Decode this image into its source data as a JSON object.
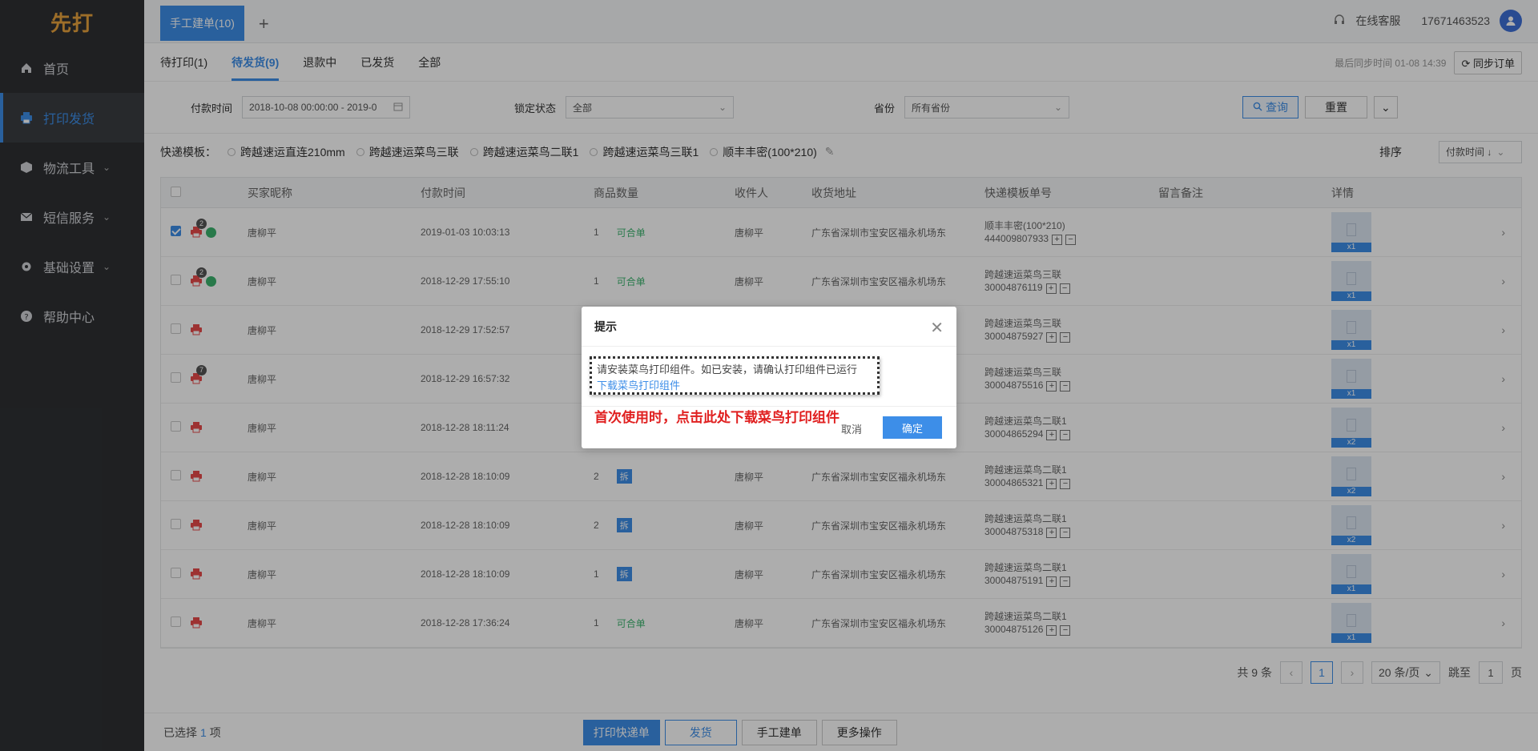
{
  "sidebar": {
    "logo": "先打",
    "items": [
      {
        "label": "首页",
        "icon": "home-icon"
      },
      {
        "label": "打印发货",
        "icon": "printer-icon"
      },
      {
        "label": "物流工具",
        "icon": "box-icon"
      },
      {
        "label": "短信服务",
        "icon": "mail-icon"
      },
      {
        "label": "基础设置",
        "icon": "gear-icon"
      },
      {
        "label": "帮助中心",
        "icon": "help-icon"
      }
    ]
  },
  "header": {
    "tab": "手工建单(10)",
    "plus": "+",
    "service": "在线客服",
    "phone": "17671463523"
  },
  "subtabs": [
    "待打印(1)",
    "待发货(9)",
    "退款中",
    "已发货",
    "全部"
  ],
  "sync": {
    "text": "最后同步时间 01-08 14:39",
    "button": "同步订单"
  },
  "filter": {
    "pay_time_label": "付款时间",
    "pay_time_value": "2018-10-08 00:00:00 - 2019-0",
    "lock_label": "锁定状态",
    "lock_value": "全部",
    "province_label": "省份",
    "province_value": "所有省份",
    "query": "查询",
    "reset": "重置"
  },
  "templates": {
    "label": "快递模板：",
    "options": [
      "跨越速运直连210mm",
      "跨越速运菜鸟三联",
      "跨越速运菜鸟二联1",
      "跨越速运菜鸟三联1",
      "顺丰丰密(100*210)"
    ],
    "sort_label": "排序",
    "sort_value": "付款时间 ↓"
  },
  "table": {
    "headers": [
      "买家昵称",
      "付款时间",
      "商品数量",
      "收件人",
      "收货地址",
      "快递模板单号",
      "留言备注",
      "详情"
    ],
    "rows": [
      {
        "buyer": "唐柳平",
        "time": "2019-01-03 10:03:13",
        "qty": "1",
        "tag": "可合单",
        "tagtype": "he",
        "recv": "唐柳平",
        "addr": "广东省深圳市宝安区福永机场东",
        "tpl": "顺丰丰密(100*210)",
        "no": "444009807933",
        "thumb": "x1",
        "checked": true,
        "badge": "2",
        "green": true
      },
      {
        "buyer": "唐柳平",
        "time": "2018-12-29 17:55:10",
        "qty": "1",
        "tag": "可合单",
        "tagtype": "he",
        "recv": "唐柳平",
        "addr": "广东省深圳市宝安区福永机场东",
        "tpl": "跨越速运菜鸟三联",
        "no": "30004876119",
        "thumb": "x1",
        "checked": false,
        "badge": "2",
        "green": true
      },
      {
        "buyer": "唐柳平",
        "time": "2018-12-29 17:52:57",
        "qty": "",
        "tag": "",
        "tagtype": "",
        "recv": "",
        "addr": "",
        "tpl": "跨越速运菜鸟三联",
        "no": "30004875927",
        "thumb": "x1",
        "checked": false,
        "badge": "",
        "green": false
      },
      {
        "buyer": "唐柳平",
        "time": "2018-12-29 16:57:32",
        "qty": "",
        "tag": "",
        "tagtype": "",
        "recv": "",
        "addr": "",
        "tpl": "跨越速运菜鸟三联",
        "no": "30004875516",
        "thumb": "x1",
        "checked": false,
        "badge": "7",
        "green": false
      },
      {
        "buyer": "唐柳平",
        "time": "2018-12-28 18:11:24",
        "qty": "",
        "tag": "",
        "tagtype": "",
        "recv": "",
        "addr": "",
        "tpl": "跨越速运菜鸟二联1",
        "no": "30004865294",
        "thumb": "x2",
        "checked": false,
        "badge": "",
        "green": false
      },
      {
        "buyer": "唐柳平",
        "time": "2018-12-28 18:10:09",
        "qty": "2",
        "tag": "拆",
        "tagtype": "chai",
        "recv": "唐柳平",
        "addr": "广东省深圳市宝安区福永机场东",
        "tpl": "跨越速运菜鸟二联1",
        "no": "30004865321",
        "thumb": "x2",
        "checked": false,
        "badge": "",
        "green": false
      },
      {
        "buyer": "唐柳平",
        "time": "2018-12-28 18:10:09",
        "qty": "2",
        "tag": "拆",
        "tagtype": "chai",
        "recv": "唐柳平",
        "addr": "广东省深圳市宝安区福永机场东",
        "tpl": "跨越速运菜鸟二联1",
        "no": "30004875318",
        "thumb": "x2",
        "checked": false,
        "badge": "",
        "green": false
      },
      {
        "buyer": "唐柳平",
        "time": "2018-12-28 18:10:09",
        "qty": "1",
        "tag": "拆",
        "tagtype": "chai",
        "recv": "唐柳平",
        "addr": "广东省深圳市宝安区福永机场东",
        "tpl": "跨越速运菜鸟二联1",
        "no": "30004875191",
        "thumb": "x1",
        "checked": false,
        "badge": "",
        "green": false
      },
      {
        "buyer": "唐柳平",
        "time": "2018-12-28 17:36:24",
        "qty": "1",
        "tag": "可合单",
        "tagtype": "he",
        "recv": "唐柳平",
        "addr": "广东省深圳市宝安区福永机场东",
        "tpl": "跨越速运菜鸟二联1",
        "no": "30004875126",
        "thumb": "x1",
        "checked": false,
        "badge": "",
        "green": false
      }
    ]
  },
  "pager": {
    "total": "共 9 条",
    "page": "1",
    "size": "20 条/页",
    "jump": "跳至",
    "jump_value": "1",
    "unit": "页"
  },
  "footer": {
    "selected": "已选择",
    "count": "1",
    "unit": "项",
    "buttons": [
      "打印快递单",
      "发货",
      "手工建单",
      "更多操作"
    ]
  },
  "modal": {
    "title": "提示",
    "message": "请安装菜鸟打印组件。如已安装，请确认打印组件已运行",
    "link": "下载菜鸟打印组件",
    "annotation": "首次使用时，点击此处下载菜鸟打印组件",
    "cancel": "取消",
    "ok": "确定"
  },
  "colors": {
    "primary": "#3d8ee8",
    "sidebar": "#2e3033",
    "green": "#3bb36e",
    "annotation": "#e02020"
  }
}
